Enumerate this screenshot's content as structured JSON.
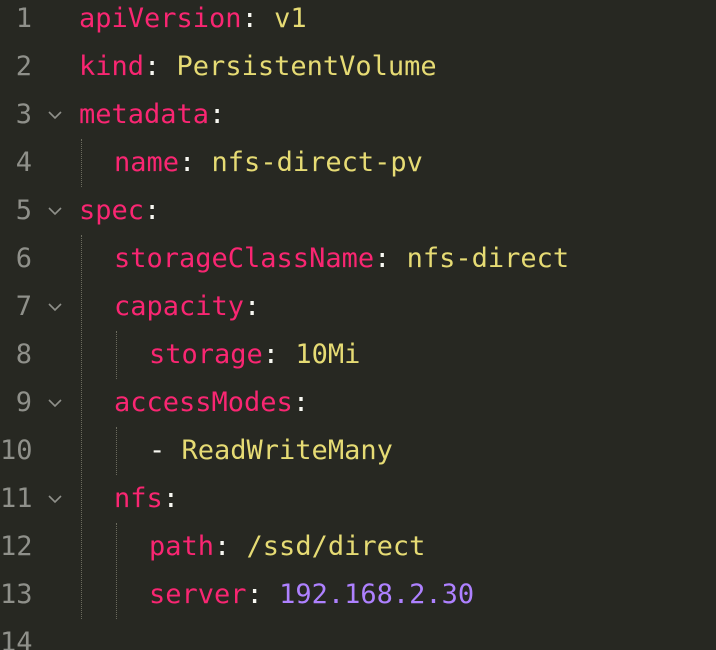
{
  "editor": {
    "lines": [
      {
        "number": "1",
        "key": "apiVersion",
        "sep": ": ",
        "value": "v1",
        "value_type": "string",
        "indent": 0,
        "fold": false
      },
      {
        "number": "2",
        "key": "kind",
        "sep": ": ",
        "value": "PersistentVolume",
        "value_type": "string",
        "indent": 0,
        "fold": false
      },
      {
        "number": "3",
        "key": "metadata",
        "sep": ":",
        "value": "",
        "value_type": "string",
        "indent": 0,
        "fold": true
      },
      {
        "number": "4",
        "key": "name",
        "sep": ": ",
        "value": "nfs-direct-pv",
        "value_type": "string",
        "indent": 1,
        "fold": false
      },
      {
        "number": "5",
        "key": "spec",
        "sep": ":",
        "value": "",
        "value_type": "string",
        "indent": 0,
        "fold": true
      },
      {
        "number": "6",
        "key": "storageClassName",
        "sep": ": ",
        "value": "nfs-direct",
        "value_type": "string",
        "indent": 1,
        "fold": false
      },
      {
        "number": "7",
        "key": "capacity",
        "sep": ":",
        "value": "",
        "value_type": "string",
        "indent": 1,
        "fold": true
      },
      {
        "number": "8",
        "key": "storage",
        "sep": ": ",
        "value": "10Mi",
        "value_type": "string",
        "indent": 2,
        "fold": false
      },
      {
        "number": "9",
        "key": "accessModes",
        "sep": ":",
        "value": "",
        "value_type": "string",
        "indent": 1,
        "fold": true
      },
      {
        "number": "10",
        "key": "",
        "sep": "- ",
        "value": "ReadWriteMany",
        "value_type": "string",
        "indent": 2,
        "fold": false
      },
      {
        "number": "11",
        "key": "nfs",
        "sep": ":",
        "value": "",
        "value_type": "string",
        "indent": 1,
        "fold": true
      },
      {
        "number": "12",
        "key": "path",
        "sep": ": ",
        "value": "/ssd/direct",
        "value_type": "string",
        "indent": 2,
        "fold": false
      },
      {
        "number": "13",
        "key": "server",
        "sep": ": ",
        "value": "192.168.2.30",
        "value_type": "number",
        "indent": 2,
        "fold": false
      },
      {
        "number": "14",
        "key": "",
        "sep": "",
        "value": "",
        "value_type": "string",
        "indent": 0,
        "fold": false
      }
    ]
  },
  "colors": {
    "background": "#272822",
    "line_number": "#8f908a",
    "key": "#f92672",
    "string": "#e6db74",
    "number": "#ae81ff",
    "punctuation": "#f8f8f2"
  }
}
